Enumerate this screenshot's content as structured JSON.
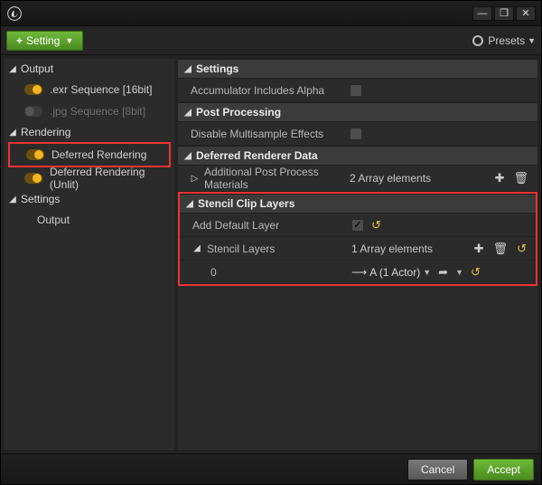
{
  "window": {
    "minimize": "—",
    "maximize": "❐",
    "close": "✕"
  },
  "toolbar": {
    "setting_label": "Setting",
    "presets_label": "Presets"
  },
  "sidebar": {
    "groups": [
      {
        "label": "Output",
        "items": [
          {
            "label": ".exr Sequence [16bit]",
            "on": true,
            "disabled": false
          },
          {
            "label": ".jpg Sequence [8bit]",
            "on": false,
            "disabled": true
          }
        ]
      },
      {
        "label": "Rendering",
        "items": [
          {
            "label": "Deferred Rendering",
            "on": true,
            "selected": true
          },
          {
            "label": "Deferred Rendering (Unlit)",
            "on": true
          }
        ]
      },
      {
        "label": "Settings",
        "items": [
          {
            "label": "Output",
            "plain": true
          }
        ]
      }
    ]
  },
  "sections": {
    "settings": {
      "title": "Settings",
      "rows": {
        "accum_alpha": {
          "label": "Accumulator Includes Alpha",
          "checked": false
        }
      }
    },
    "post": {
      "title": "Post Processing",
      "rows": {
        "disable_ms": {
          "label": "Disable Multisample Effects",
          "checked": false
        }
      }
    },
    "renderer": {
      "title": "Deferred Renderer Data",
      "rows": {
        "addl_pp": {
          "label": "Additional Post Process Materials",
          "value": "2 Array elements"
        }
      }
    },
    "stencil": {
      "title": "Stencil Clip Layers",
      "rows": {
        "add_default": {
          "label": "Add Default Layer",
          "checked": true
        },
        "layers": {
          "label": "Stencil Layers",
          "value": "1 Array elements"
        },
        "layer0": {
          "label": "0",
          "value": "A (1 Actor)"
        }
      }
    }
  },
  "footer": {
    "cancel": "Cancel",
    "accept": "Accept"
  }
}
